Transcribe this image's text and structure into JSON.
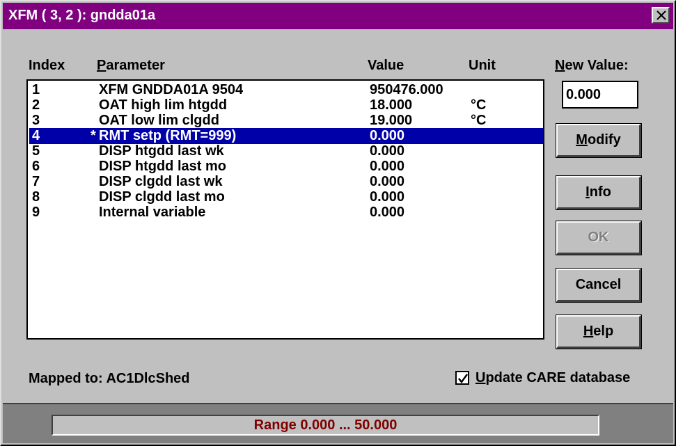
{
  "window": {
    "title": "XFM ( 3, 2 ): gndda01a"
  },
  "columns": {
    "index": "Index",
    "parameter": "Parameter",
    "value": "Value",
    "unit": "Unit",
    "new_value": "New Value:"
  },
  "rows": [
    {
      "index": "1",
      "mark": "",
      "parameter": "XFM GNDDA01A 9504",
      "value": "950476.000",
      "unit": ""
    },
    {
      "index": "2",
      "mark": "",
      "parameter": "OAT high lim htgdd",
      "value": "18.000",
      "unit": "°C"
    },
    {
      "index": "3",
      "mark": "",
      "parameter": "OAT low lim clgdd",
      "value": "19.000",
      "unit": "°C"
    },
    {
      "index": "4",
      "mark": "*",
      "parameter": "RMT setp (RMT=999)",
      "value": "0.000",
      "unit": ""
    },
    {
      "index": "5",
      "mark": "",
      "parameter": "DISP htgdd last wk",
      "value": "0.000",
      "unit": ""
    },
    {
      "index": "6",
      "mark": "",
      "parameter": "DISP htgdd last mo",
      "value": "0.000",
      "unit": ""
    },
    {
      "index": "7",
      "mark": "",
      "parameter": "DISP clgdd last wk",
      "value": "0.000",
      "unit": ""
    },
    {
      "index": "8",
      "mark": "",
      "parameter": "DISP clgdd last mo",
      "value": "0.000",
      "unit": ""
    },
    {
      "index": "9",
      "mark": "",
      "parameter": "Internal variable",
      "value": "0.000",
      "unit": ""
    }
  ],
  "selected_row": "4",
  "new_value_input": "0.000",
  "buttons": {
    "modify": "Modify",
    "info": "Info",
    "ok": "OK",
    "cancel": "Cancel",
    "help": "Help"
  },
  "mapped_to": "Mapped to: AC1DlcShed",
  "update_checkbox": {
    "label": "Update CARE database",
    "checked": true
  },
  "status": {
    "range": "Range 0.000 ... 50.000"
  },
  "colors": {
    "titlebar": "#800080",
    "selection": "#0000a8",
    "range_text": "#800000"
  }
}
